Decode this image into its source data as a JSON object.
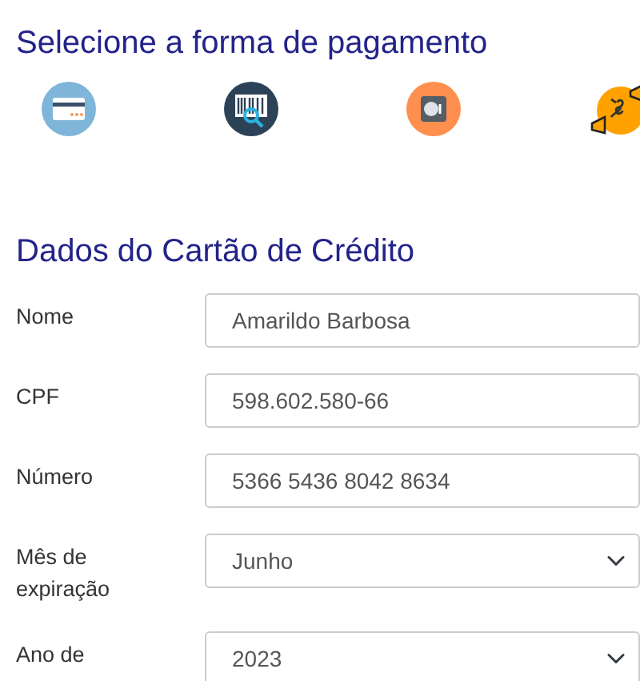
{
  "payment_section": {
    "title": "Selecione a forma de pagamento",
    "methods": [
      {
        "kind": "card"
      },
      {
        "kind": "barcode"
      },
      {
        "kind": "safe"
      },
      {
        "kind": "money"
      }
    ]
  },
  "card_form": {
    "title": "Dados do Cartão de Crédito",
    "fields": [
      {
        "kind": "text",
        "label": "Nome",
        "value": "Amarildo Barbosa"
      },
      {
        "kind": "text",
        "label": "CPF",
        "value": "598.602.580-66"
      },
      {
        "kind": "text",
        "label": "Número",
        "value": "5366 5436 8042 8634"
      },
      {
        "kind": "select",
        "label": "Mês de expiração",
        "value": "Junho"
      },
      {
        "kind": "select",
        "label": "Ano de",
        "value": "2023"
      }
    ]
  }
}
